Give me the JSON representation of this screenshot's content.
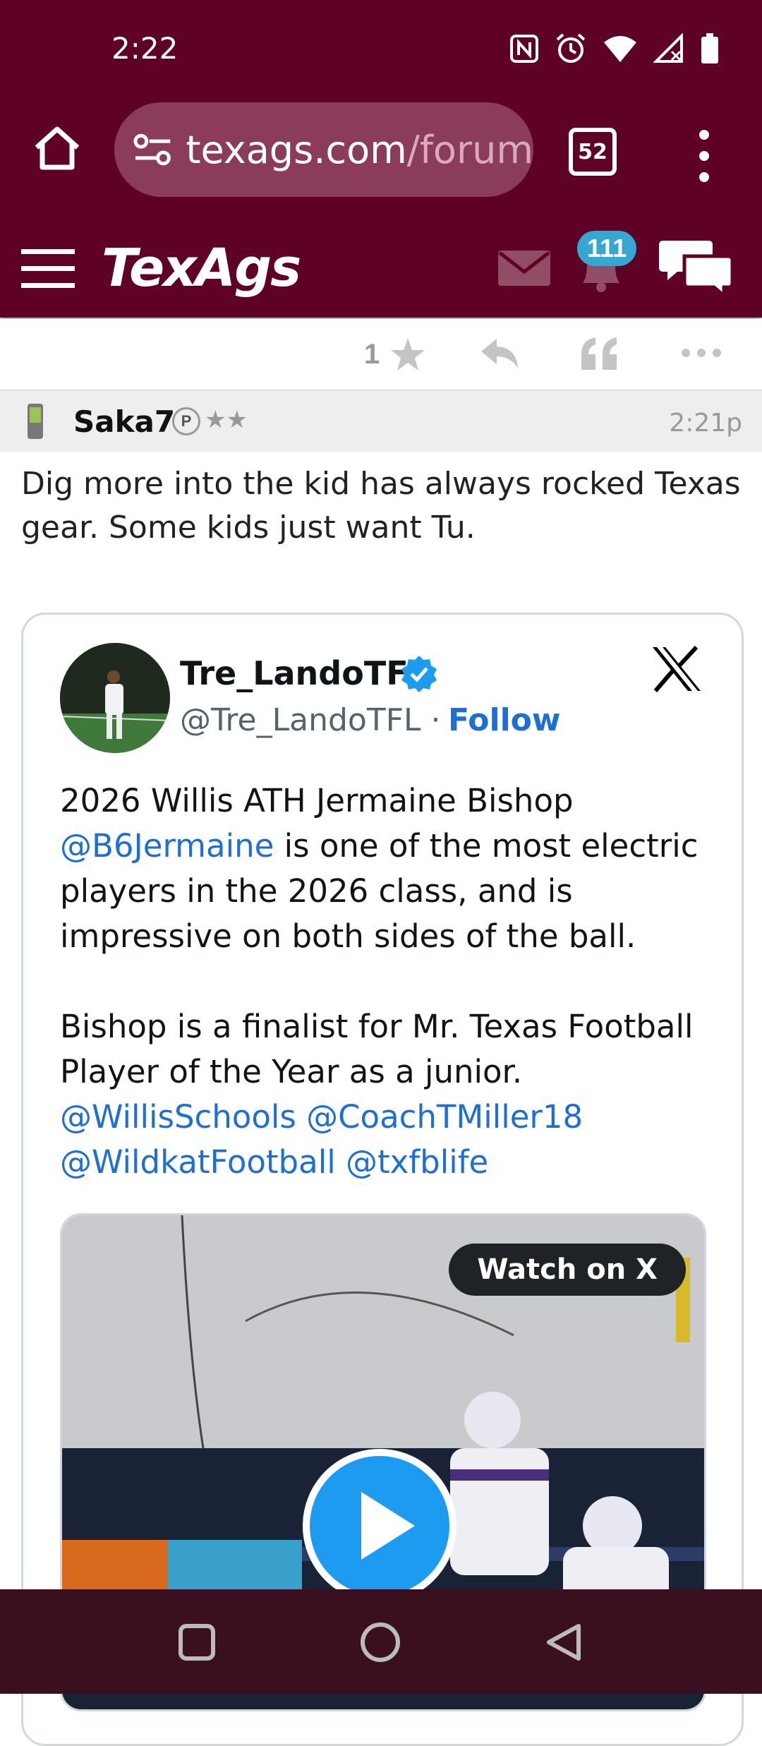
{
  "status_bar": {
    "time": "2:22"
  },
  "browser": {
    "url_host": "texags.com",
    "url_rest": "/forum",
    "tab_count": "52"
  },
  "site_header": {
    "logo": "TexAgs",
    "notification_count": "111"
  },
  "post_actions": {
    "star_count": "1"
  },
  "post": {
    "author": "Saka7",
    "badge": "P",
    "stars": "★★",
    "time": "2:21p",
    "text": "Dig more into the kid has always rocked Texas gear. Some kids just want Tu."
  },
  "tweet": {
    "name": "Tre_LandoTFL",
    "handle": "@Tre_LandoTFL",
    "separator": "·",
    "follow": "Follow",
    "line1": "2026 Willis ATH Jermaine Bishop",
    "mention1": "@B6Jermaine",
    "line2_rest": " is one of the most electric players in the 2026 class, and is impressive on both sides of the ball.",
    "para2": "Bishop is a finalist for Mr. Texas Football Player of the Year as a junior.",
    "mention2": "@WillisSchools",
    "mention3": "@CoachTMiller18",
    "mention4": "@WildkatFootball",
    "mention5": "@txfblife",
    "watch_label": "Watch on X"
  },
  "colors": {
    "maroon": "#5f0026",
    "link_blue": "#1d6fd6",
    "verified_blue": "#1d9bf0"
  }
}
